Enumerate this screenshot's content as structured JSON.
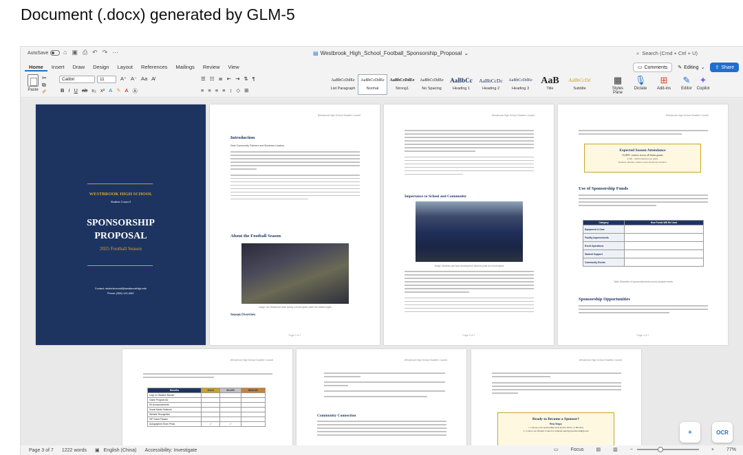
{
  "caption": "Document (.docx) generated by GLM-5",
  "titlebar": {
    "autosave_label": "AutoSave",
    "document_title": "Westbrook_High_School_Football_Sponsorship_Proposal",
    "search_placeholder": "Search (Cmd + Ctrl + U)"
  },
  "tabs": [
    "Home",
    "Insert",
    "Draw",
    "Design",
    "Layout",
    "References",
    "Mailings",
    "Review",
    "View"
  ],
  "right_controls": {
    "comments": "Comments",
    "editing": "Editing",
    "share": "Share"
  },
  "ribbon": {
    "paste": "Paste",
    "font_name": "Calibri",
    "font_size": "11",
    "styles": [
      {
        "sample": "AaBbCcDdEe",
        "name": "List Paragraph"
      },
      {
        "sample": "AaBbCcDdEe",
        "name": "Normal"
      },
      {
        "sample": "AaBbCcDdEe",
        "name": "Strong1"
      },
      {
        "sample": "AaBbCcDdEe",
        "name": "No Spacing"
      },
      {
        "sample": "AaBbCc",
        "name": "Heading 1"
      },
      {
        "sample": "AaBbCcDc",
        "name": "Heading 2"
      },
      {
        "sample": "AaBbCcDdEe",
        "name": "Heading 3"
      },
      {
        "sample": "AaB",
        "name": "Title"
      },
      {
        "sample": "AaBbCcDd",
        "name": "Subtitle"
      }
    ],
    "styles_pane": "Styles Pane",
    "dictate": "Dictate",
    "addins": "Add-ins",
    "editor": "Editor",
    "copilot": "Copilot"
  },
  "cover": {
    "school": "WESTBROOK HIGH SCHOOL",
    "council": "Student Council",
    "title_line1": "SPONSORSHIP",
    "title_line2": "PROPOSAL",
    "season": "2025 Football Season",
    "contact": "Contact: studentcouncil@westbrookhigh.edu",
    "phone": "Phone: (555) 123-4567"
  },
  "page_header": "Westbrook High School Student Council",
  "page2": {
    "h_intro": "Introduction",
    "greeting": "Dear Community Partners and Business Leaders,",
    "h_about": "About the Football Season",
    "photo_caption": "Image: Our Westbrook team during a recent game under the stadium lights",
    "h_overview": "Season Overview",
    "footer": "Page 2 of 7"
  },
  "page3": {
    "h_importance": "Importance to School and Community",
    "photo_caption": "Image: Students and fans showing their Warriors pride at a home game",
    "footer": "Page 3 of 7"
  },
  "page4": {
    "callout_title": "Expected Season Attendance",
    "callout_line1": "15,000+ visitors across all home games",
    "callout_line2": "2,500 - 4,000 attendees per game",
    "callout_line3": "Students, families, alumni, and community members",
    "h_funds": "Use of Sponsorship Funds",
    "table_head": [
      "Category",
      "How Funds Will Be Used"
    ],
    "table_rows": [
      "Equipment & Gear",
      "Facility Improvements",
      "Event Operations",
      "Student Support",
      "Community Events"
    ],
    "table_caption": "Table: Allocation of sponsorship funds across program needs",
    "h_opps": "Sponsorship Opportunities",
    "footer": "Page 4 of 7"
  },
  "page5": {
    "tiers": [
      "Benefits",
      "GOLD",
      "SILVER",
      "BRONZE"
    ],
    "rows": [
      "Logo on Stadium Banner",
      "Game Program Ad",
      "PA Announcements",
      "Social Media Features",
      "Website Recognition",
      "VIP Game Passes",
      "Autographed Team Photo"
    ]
  },
  "page6": {
    "h_connection": "Community Connection"
  },
  "page7": {
    "callout_title": "Ready to Become a Sponsor?",
    "callout_sub": "Next Steps:",
    "steps": [
      "1. Choose your sponsorship level (Gold, Silver, or Bronze)",
      "2. Contact our Student Council at studentcouncil@westbrookhigh.edu"
    ]
  },
  "status": {
    "page": "Page 3 of 7",
    "words": "1222 words",
    "language": "English (China)",
    "accessibility": "Accessibility: Investigate",
    "focus": "Focus",
    "zoom": "77%"
  },
  "colors": {
    "navy": "#1d3461",
    "gold": "#c9a227",
    "accent": "#1f6fd1"
  }
}
